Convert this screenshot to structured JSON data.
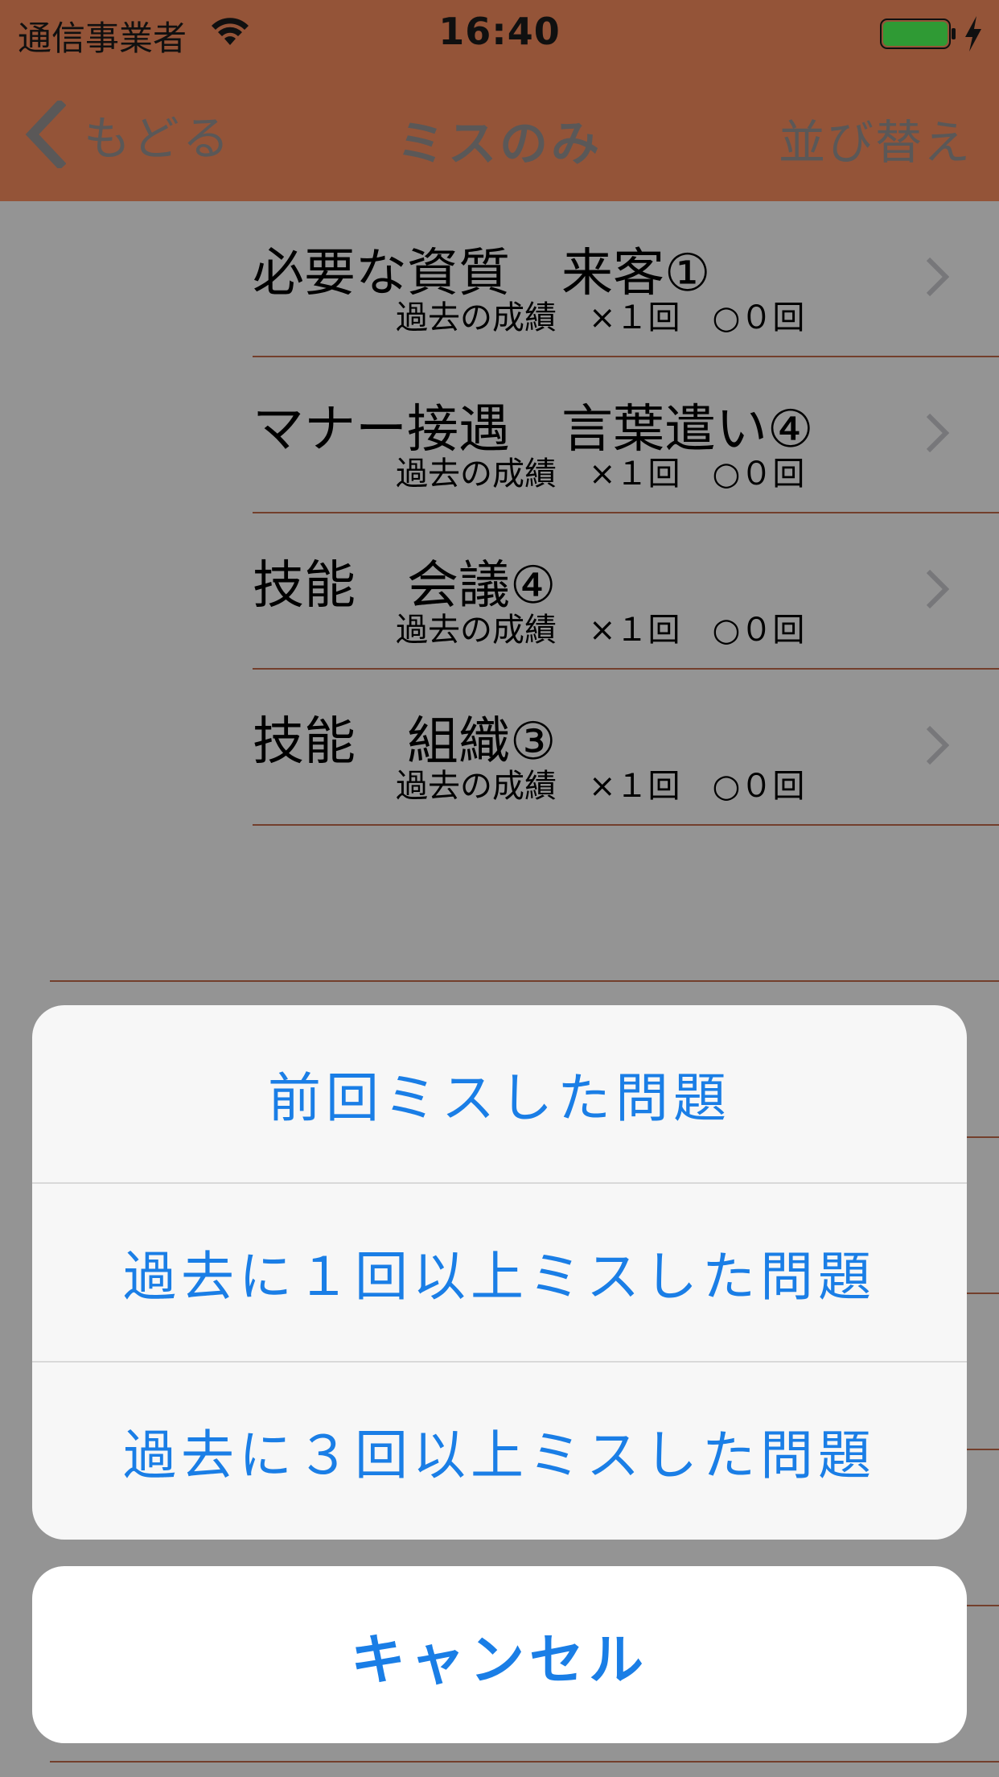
{
  "status_bar": {
    "carrier": "通信事業者",
    "time": "16:40",
    "battery_color": "#2f9a34"
  },
  "nav": {
    "back_label": "もどる",
    "title": "ミスのみ",
    "sort_label": "並び替え"
  },
  "list": {
    "rows": [
      {
        "title": "必要な資質　来客①",
        "stats": "過去の成績　×１回　○０回"
      },
      {
        "title": "マナー接遇　言葉遣い④",
        "stats": "過去の成績　×１回　○０回"
      },
      {
        "title": "技能　会議④",
        "stats": "過去の成績　×１回　○０回"
      },
      {
        "title": "技能　組織③",
        "stats": "過去の成績　×１回　○０回"
      }
    ]
  },
  "action_sheet": {
    "options": [
      {
        "label": "前回ミスした問題"
      },
      {
        "label": "過去に１回以上ミスした問題"
      },
      {
        "label": "過去に３回以上ミスした問題"
      }
    ],
    "cancel_label": "キャンセル"
  },
  "colors": {
    "accent": "#945438",
    "separator": "#c06a4a",
    "action_text": "#1a7ee6"
  }
}
